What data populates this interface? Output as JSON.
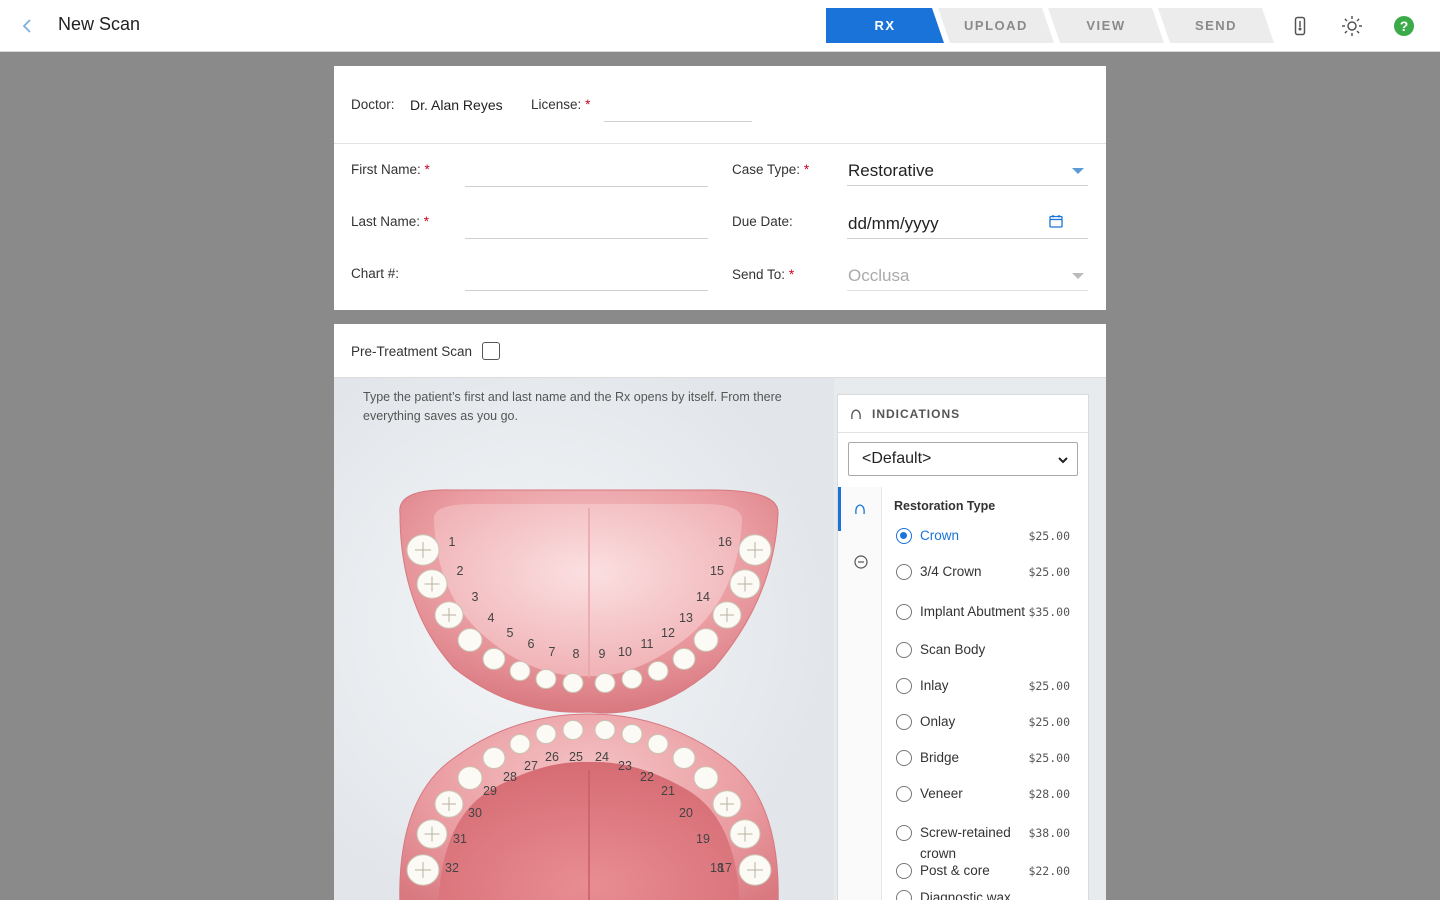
{
  "header": {
    "title": "New Scan",
    "steps": [
      {
        "label": "RX",
        "active": true
      },
      {
        "label": "UPLOAD",
        "active": false
      },
      {
        "label": "VIEW",
        "active": false
      },
      {
        "label": "SEND",
        "active": false
      }
    ],
    "icons": [
      "arrow-left-icon",
      "thermometer-icon",
      "brightness-icon",
      "help-icon"
    ],
    "accent": "#1a73d9"
  },
  "doctor": {
    "doctor_label": "Doctor:",
    "doctor_name": "Dr. Alan Reyes",
    "license_label": "License:",
    "license_value": ""
  },
  "patient": {
    "first_name_label": "First Name:",
    "first_name_value": "",
    "last_name_label": "Last Name:",
    "last_name_value": "",
    "chart_label": "Chart #:",
    "chart_value": "",
    "case_type_label": "Case Type:",
    "case_type_value": "Restorative",
    "due_date_label": "Due Date:",
    "due_date_placeholder": "dd/mm/yyyy",
    "send_to_label": "Send To:",
    "send_to_value": "Occlusa",
    "required_mark": "*"
  },
  "scan": {
    "pre_treatment_label": "Pre-Treatment Scan",
    "pre_treatment_checked": false,
    "hint": "Type the patient’s first and last name and the Rx opens by itself. From there everything saves as you go."
  },
  "teeth": {
    "upper": [
      "1",
      "2",
      "3",
      "4",
      "5",
      "6",
      "7",
      "8",
      "9",
      "10",
      "11",
      "12",
      "13",
      "14",
      "15",
      "16"
    ],
    "lower": [
      "17",
      "18",
      "19",
      "20",
      "21",
      "22",
      "23",
      "24",
      "25",
      "26",
      "27",
      "28",
      "29",
      "30",
      "31",
      "32"
    ]
  },
  "indications": {
    "title": "INDICATIONS",
    "preset": "<Default>",
    "section_title": "Restoration Type",
    "options": [
      {
        "label": "Crown",
        "price": "$25.00",
        "selected": true
      },
      {
        "label": "3/4 Crown",
        "price": "$25.00",
        "selected": false
      },
      {
        "label": "Implant Abutment",
        "price": "$35.00",
        "selected": false
      },
      {
        "label": "Scan Body",
        "price": "",
        "selected": false
      },
      {
        "label": "Inlay",
        "price": "$25.00",
        "selected": false
      },
      {
        "label": "Onlay",
        "price": "$25.00",
        "selected": false
      },
      {
        "label": "Bridge",
        "price": "$25.00",
        "selected": false
      },
      {
        "label": "Veneer",
        "price": "$28.00",
        "selected": false
      },
      {
        "label": "Screw-retained crown",
        "price": "$38.00",
        "selected": false
      },
      {
        "label": "Post & core",
        "price": "$22.00",
        "selected": false
      },
      {
        "label": "Diagnostic wax",
        "price": "",
        "selected": false
      }
    ]
  }
}
